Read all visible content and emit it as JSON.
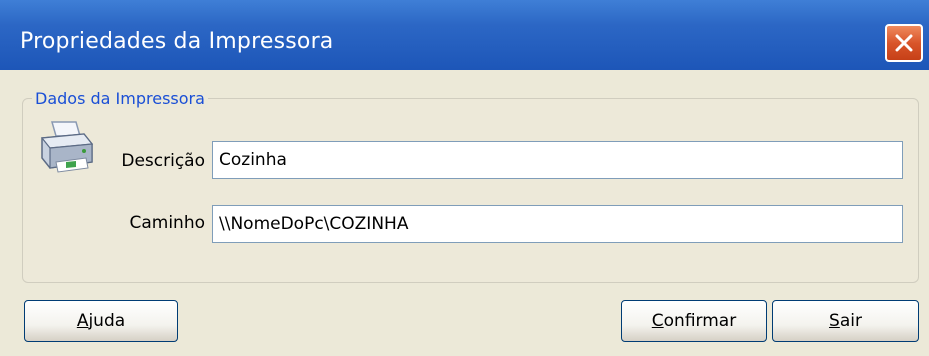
{
  "window": {
    "title": "Propriedades da Impressora"
  },
  "group": {
    "legend": "Dados da Impressora"
  },
  "fields": {
    "descricao_label": "Descrição",
    "descricao_value": "Cozinha",
    "caminho_label": "Caminho",
    "caminho_value": "\\\\NomeDoPc\\COZINHA"
  },
  "buttons": {
    "ajuda_mnemonic": "A",
    "ajuda_rest": "juda",
    "confirmar_mnemonic": "C",
    "confirmar_rest": "onfirmar",
    "sair_mnemonic": "S",
    "sair_rest": "air"
  },
  "icons": {
    "printer": "printer-icon",
    "close": "close-icon"
  },
  "colors": {
    "titlebar": "#2c67c5",
    "legend": "#1a4fd6",
    "close": "#d9552a",
    "background": "#ece9d8"
  }
}
